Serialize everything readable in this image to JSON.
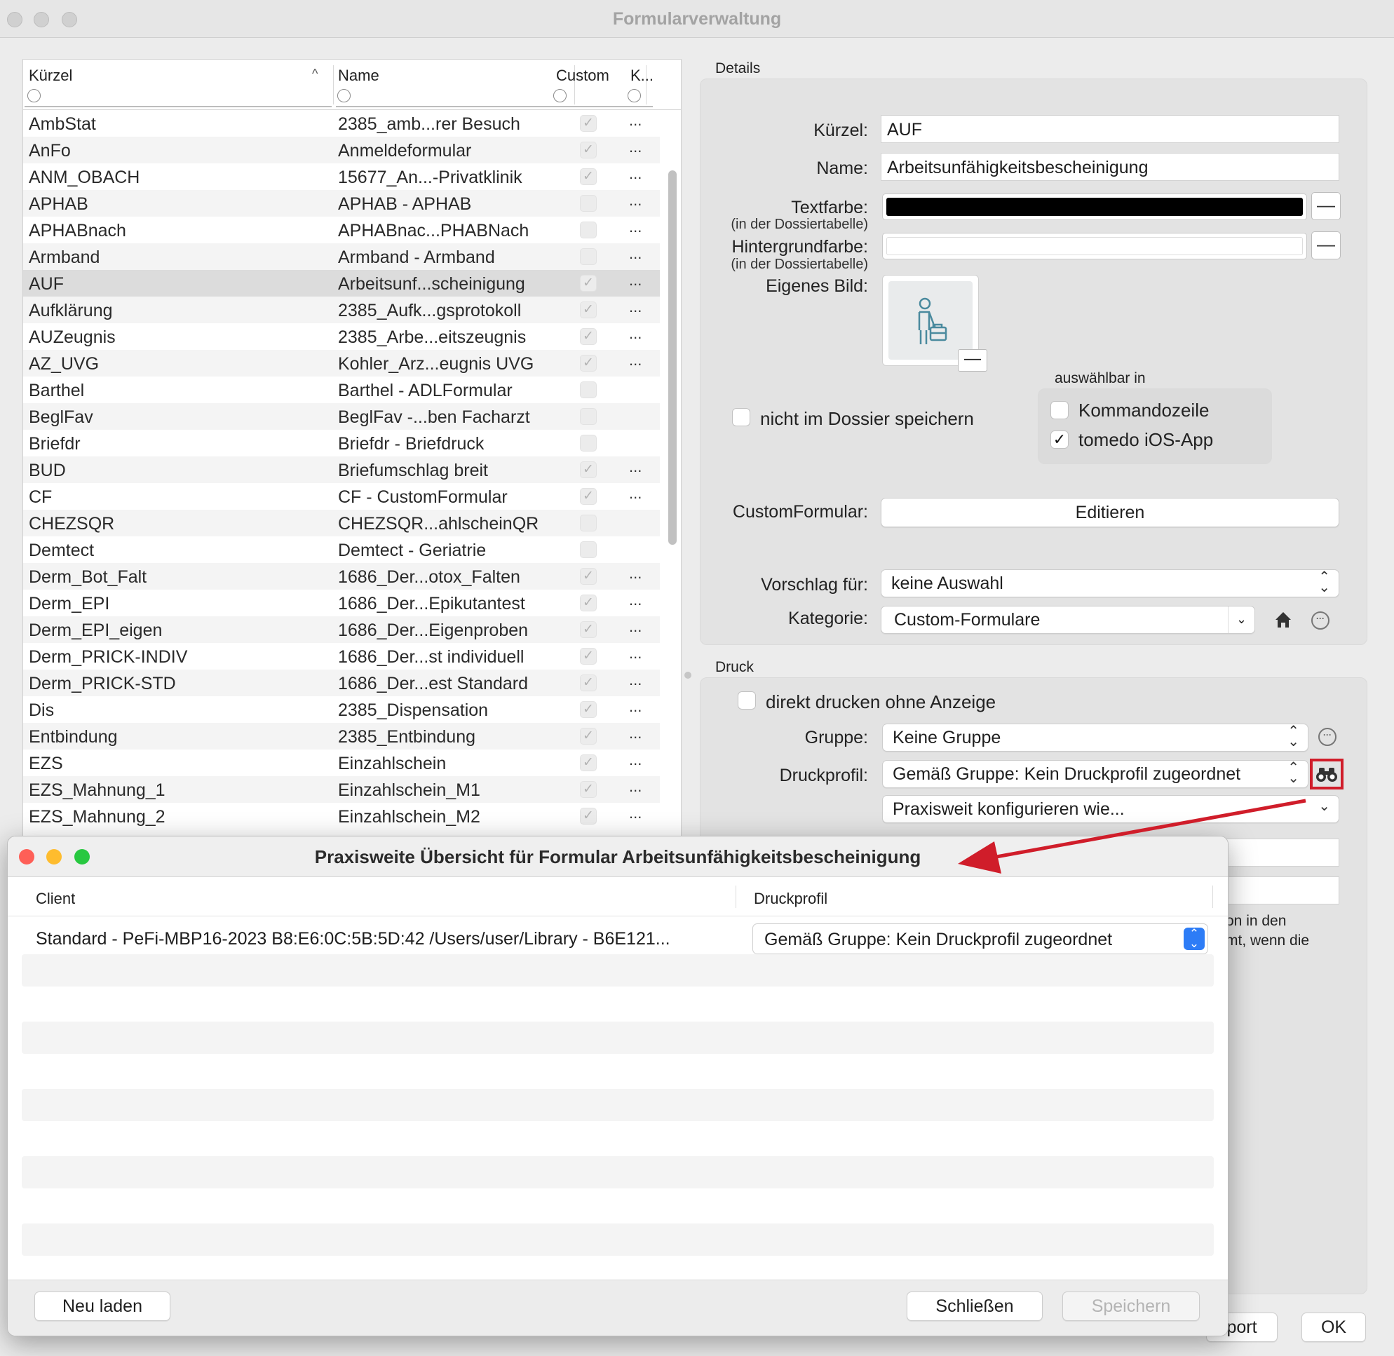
{
  "window": {
    "title": "Formularverwaltung"
  },
  "table": {
    "columns": {
      "kuerzel": "Kürzel",
      "name": "Name",
      "custom": "Custom",
      "k": "K..."
    },
    "rows": [
      {
        "kuerzel": "AmbStat",
        "name": "2385_amb...rer Besuch",
        "custom": true,
        "more": "..."
      },
      {
        "kuerzel": "AnFo",
        "name": "Anmeldeformular",
        "custom": true,
        "more": "..."
      },
      {
        "kuerzel": "ANM_OBACH",
        "name": "15677_An...-Privatklinik",
        "custom": true,
        "more": "..."
      },
      {
        "kuerzel": "APHAB",
        "name": "APHAB - APHAB",
        "custom": false,
        "more": "..."
      },
      {
        "kuerzel": "APHABnach",
        "name": "APHABnac...PHABNach",
        "custom": false,
        "more": "..."
      },
      {
        "kuerzel": "Armband",
        "name": "Armband - Armband",
        "custom": false,
        "more": "..."
      },
      {
        "kuerzel": "AUF",
        "name": "Arbeitsunf...scheinigung",
        "custom": true,
        "more": "...",
        "selected": true
      },
      {
        "kuerzel": "Aufklärung",
        "name": "2385_Aufk...gsprotokoll",
        "custom": true,
        "more": "..."
      },
      {
        "kuerzel": "AUZeugnis",
        "name": "2385_Arbe...eitszeugnis",
        "custom": true,
        "more": "..."
      },
      {
        "kuerzel": "AZ_UVG",
        "name": "Kohler_Arz...eugnis UVG",
        "custom": true,
        "more": "..."
      },
      {
        "kuerzel": "Barthel",
        "name": "Barthel - ADLFormular",
        "custom": false,
        "more": ""
      },
      {
        "kuerzel": "BeglFav",
        "name": "BeglFav -...ben Facharzt",
        "custom": false,
        "more": ""
      },
      {
        "kuerzel": "Briefdr",
        "name": "Briefdr - Briefdruck",
        "custom": false,
        "more": ""
      },
      {
        "kuerzel": "BUD",
        "name": "Briefumschlag breit",
        "custom": true,
        "more": "..."
      },
      {
        "kuerzel": "CF",
        "name": "CF - CustomFormular",
        "custom": true,
        "more": "..."
      },
      {
        "kuerzel": "CHEZSQR",
        "name": "CHEZSQR...ahlscheinQR",
        "custom": false,
        "more": ""
      },
      {
        "kuerzel": "Demtect",
        "name": "Demtect - Geriatrie",
        "custom": false,
        "more": ""
      },
      {
        "kuerzel": "Derm_Bot_Falt",
        "name": "1686_Der...otox_Falten",
        "custom": true,
        "more": "..."
      },
      {
        "kuerzel": "Derm_EPI",
        "name": "1686_Der...Epikutantest",
        "custom": true,
        "more": "..."
      },
      {
        "kuerzel": "Derm_EPI_eigen",
        "name": "1686_Der...Eigenproben",
        "custom": true,
        "more": "..."
      },
      {
        "kuerzel": "Derm_PRICK-INDIV",
        "name": "1686_Der...st individuell",
        "custom": true,
        "more": "..."
      },
      {
        "kuerzel": "Derm_PRICK-STD",
        "name": "1686_Der...est Standard",
        "custom": true,
        "more": "..."
      },
      {
        "kuerzel": "Dis",
        "name": "2385_Dispensation",
        "custom": true,
        "more": "..."
      },
      {
        "kuerzel": "Entbindung",
        "name": "2385_Entbindung",
        "custom": true,
        "more": "..."
      },
      {
        "kuerzel": "EZS",
        "name": "Einzahlschein",
        "custom": true,
        "more": "..."
      },
      {
        "kuerzel": "EZS_Mahnung_1",
        "name": "Einzahlschein_M1",
        "custom": true,
        "more": "..."
      },
      {
        "kuerzel": "EZS_Mahnung_2",
        "name": "Einzahlschein_M2",
        "custom": true,
        "more": "..."
      }
    ]
  },
  "details": {
    "section_label": "Details",
    "kuerzel_label": "Kürzel:",
    "kuerzel_value": "AUF",
    "name_label": "Name:",
    "name_value": "Arbeitsunfähigkeitsbescheinigung",
    "textfarbe_label": "Textfarbe:",
    "textfarbe_sub": "(in der Dossiertabelle)",
    "textfarbe_color": "#000000",
    "hintergrund_label": "Hintergrundfarbe:",
    "hintergrund_sub": "(in der Dossiertabelle)",
    "hintergrund_color": "#ffffff",
    "minus": "—",
    "bild_label": "Eigenes Bild:",
    "bild_icon": "person-briefcase-icon",
    "nicht_speichern_label": "nicht im Dossier speichern",
    "auswaehlbar_label": "auswählbar in",
    "kommandozeile_label": "Kommandozeile",
    "ios_label": "tomedo iOS-App",
    "kommandozeile_checked": false,
    "ios_checked": true,
    "check_mark": "✓",
    "customformular_label": "CustomFormular:",
    "editieren_button": "Editieren",
    "vorschlag_label": "Vorschlag für:",
    "vorschlag_value": "keine Auswahl",
    "kategorie_label": "Kategorie:",
    "kategorie_value": "Custom-Formulare"
  },
  "druck": {
    "section_label": "Druck",
    "direkt_label": "direkt drucken ohne Anzeige",
    "gruppe_label": "Gruppe:",
    "gruppe_value": "Keine Gruppe",
    "druckprofil_label": "Druckprofil:",
    "druckprofil_value": "Gemäß Gruppe: Kein Druckprofil zugeordnet",
    "praxisweit_value": "Praxisweit konfigurieren wie...",
    "partial_text_1": "on in den",
    "partial_text_2": "mt, wenn die"
  },
  "footer": {
    "import_partial": "port",
    "ok_button": "OK"
  },
  "dialog": {
    "title": "Praxisweite Übersicht für Formular Arbeitsunfähigkeitsbescheinigung",
    "col_client": "Client",
    "col_druckprofil": "Druckprofil",
    "row_client": "Standard - PeFi-MBP16-2023 B8:E6:0C:5B:5D:42 /Users/user/Library - B6E121...",
    "row_druckprofil": "Gemäß Gruppe: Kein Druckprofil zugeordnet",
    "neu_laden_button": "Neu laden",
    "schliessen_button": "Schließen",
    "speichern_button": "Speichern"
  },
  "colors": {
    "highlight": "#d01d2a",
    "accent_blue": "#2d7cf6",
    "traffic_red": "#fe5f57",
    "traffic_yellow": "#febc2e",
    "traffic_green": "#28c840"
  }
}
